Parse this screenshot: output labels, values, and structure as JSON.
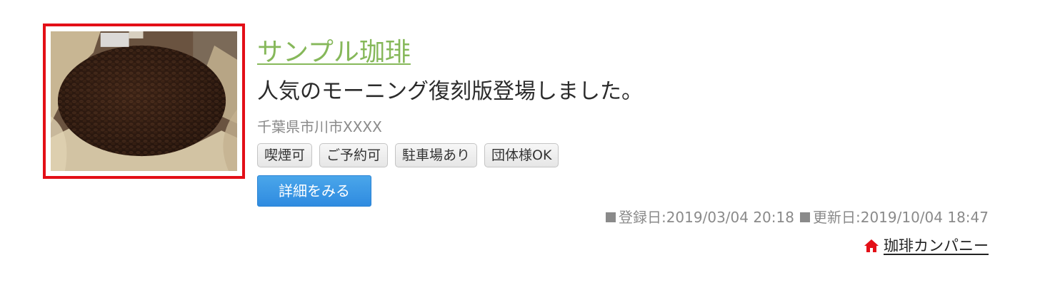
{
  "shop": {
    "image_alt": "coffee-beans-photo",
    "title": "サンプル珈琲",
    "catchphrase": "人気のモーニング復刻版登場しました。",
    "address": "千葉県市川市XXXX",
    "tags": [
      "喫煙可",
      "ご予約可",
      "駐車場あり",
      "団体様OK"
    ],
    "detail_button": "詳細をみる",
    "registered": "登録日:2019/03/04 20:18",
    "updated": "更新日:2019/10/04 18:47",
    "company": "珈琲カンパニー"
  },
  "colors": {
    "title": "#86b85a",
    "image_border": "#e30f17",
    "button": "#2f8be0",
    "home_icon": "#e30f17"
  },
  "icons": {
    "home": "home-icon",
    "square": "square-bullet-icon"
  }
}
